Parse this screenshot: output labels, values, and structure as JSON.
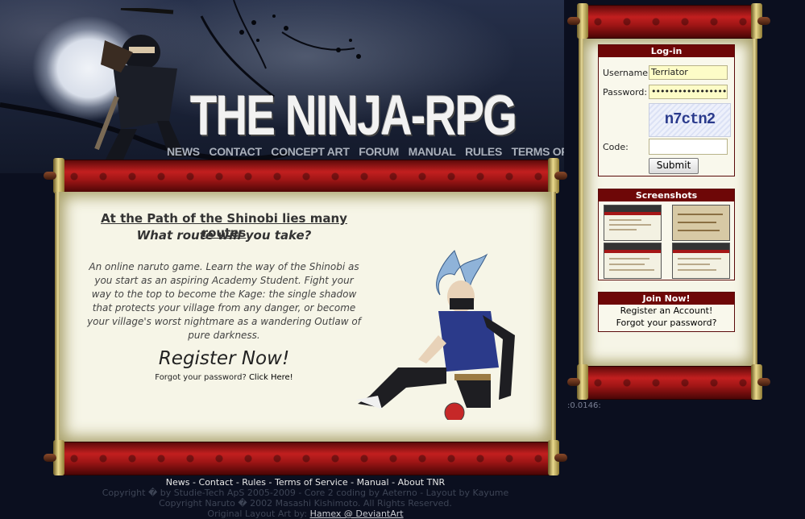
{
  "header": {
    "logo_text": "THE NINJA-RPG",
    "nav": [
      "NEWS",
      "CONTACT",
      "CONCEPT ART",
      "FORUM",
      "MANUAL",
      "RULES",
      "TERMS OF SERVICE"
    ]
  },
  "main": {
    "tagline": "At the Path of the Shinobi lies many routes",
    "subtagline": "What route will you take?",
    "intro": "An online naruto game. Learn the way of the Shinobi as you start as an aspiring Academy Student. Fight your way to the top to become the Kage: the single shadow that protects your village from any danger, or become your village's worst nightmare as a wandering Outlaw of pure darkness.",
    "register_now": "Register Now!",
    "forgot_prefix": "Forgot your password?",
    "forgot_link": "Click Here!"
  },
  "login": {
    "title": "Log-in",
    "username_label": "Username:",
    "username_value": "Terriator",
    "password_label": "Password:",
    "password_value": "••••••••••••••••••",
    "captcha_text": "n7ctn2",
    "code_label": "Code:",
    "code_value": "",
    "submit_label": "Submit"
  },
  "screenshots": {
    "title": "Screenshots"
  },
  "join": {
    "title": "Join Now!",
    "register_link": "Register an Account!",
    "forgot_link": "Forgot your password?"
  },
  "timer_text": ":0.0146:",
  "footer": {
    "nav": [
      "News",
      "Contact",
      "Rules",
      "Terms of Service",
      "Manual",
      "About TNR"
    ],
    "line1": "Copyright � by Studie-Tech ApS 2005-2009 - Core 2 coding by Aeterno - Layout by Kayume",
    "line2": "Copyright Naruto � 2002 Masashi Kishimoto. All Rights Reserved.",
    "line3_prefix": "Original Layout Art by:",
    "line3_link": "Hamex @ DeviantArt"
  }
}
